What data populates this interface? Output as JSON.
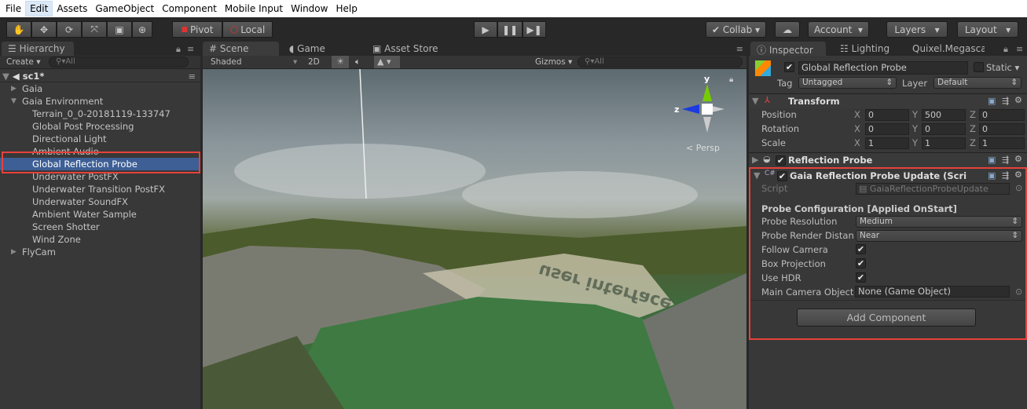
{
  "menu": [
    "File",
    "Edit",
    "Assets",
    "GameObject",
    "Component",
    "Mobile Input",
    "Window",
    "Help"
  ],
  "toolbar": {
    "pivot": "Pivot",
    "local": "Local",
    "collab": "Collab",
    "account": "Account",
    "layers": "Layers",
    "layout": "Layout"
  },
  "hierarchy": {
    "tab": "Hierarchy",
    "create": "Create",
    "search": "All",
    "scene": "sc1*",
    "items": [
      {
        "label": "Gaia",
        "depth": 1,
        "arrow": "right"
      },
      {
        "label": "Gaia Environment",
        "depth": 1,
        "arrow": "down"
      },
      {
        "label": "Terrain_0_0-20181119-133747",
        "depth": 2
      },
      {
        "label": "Global Post Processing",
        "depth": 2
      },
      {
        "label": "Directional Light",
        "depth": 2
      },
      {
        "label": "Ambient Audio",
        "depth": 2
      },
      {
        "label": "Global Reflection Probe",
        "depth": 2,
        "selected": true
      },
      {
        "label": "Underwater PostFX",
        "depth": 2
      },
      {
        "label": "Underwater Transition PostFX",
        "depth": 2
      },
      {
        "label": "Underwater SoundFX",
        "depth": 2
      },
      {
        "label": "Ambient Water Sample",
        "depth": 2
      },
      {
        "label": "Screen Shotter",
        "depth": 2
      },
      {
        "label": "Wind Zone",
        "depth": 2
      },
      {
        "label": "FlyCam",
        "depth": 1,
        "arrow": "right"
      }
    ]
  },
  "scene": {
    "tabs": [
      "Scene",
      "Game",
      "Asset Store"
    ],
    "shading": "Shaded",
    "mode2d": "2D",
    "gizmos": "Gizmos",
    "search": "All",
    "persp": "Persp",
    "axis_y": "y",
    "axis_z": "z",
    "watermark": "user interface"
  },
  "inspector": {
    "tabs": [
      "Inspector",
      "Lighting",
      "Quixel.Megasca"
    ],
    "object_name": "Global Reflection Probe",
    "static": "Static",
    "tag_label": "Tag",
    "tag": "Untagged",
    "layer_label": "Layer",
    "layer": "Default",
    "transform": {
      "title": "Transform",
      "rows": [
        {
          "label": "Position",
          "x": "0",
          "y": "500",
          "z": "0"
        },
        {
          "label": "Rotation",
          "x": "0",
          "y": "0",
          "z": "0"
        },
        {
          "label": "Scale",
          "x": "1",
          "y": "1",
          "z": "1"
        }
      ]
    },
    "reflection_probe": "Reflection Probe",
    "script_comp": {
      "title": "Gaia Reflection Probe Update (Scri",
      "script_label": "Script",
      "script": "GaiaReflectionProbeUpdate",
      "section": "Probe Configuration [Applied OnStart]",
      "resolution_label": "Probe Resolution",
      "resolution": "Medium",
      "distance_label": "Probe Render Distan",
      "distance": "Near",
      "follow": "Follow Camera",
      "box": "Box Projection",
      "hdr": "Use HDR",
      "camera_label": "Main Camera Object",
      "camera": "None (Game Object)"
    },
    "add_component": "Add Component"
  },
  "colors": {
    "selection": "#3e5f96",
    "highlight": "#e8413a"
  }
}
